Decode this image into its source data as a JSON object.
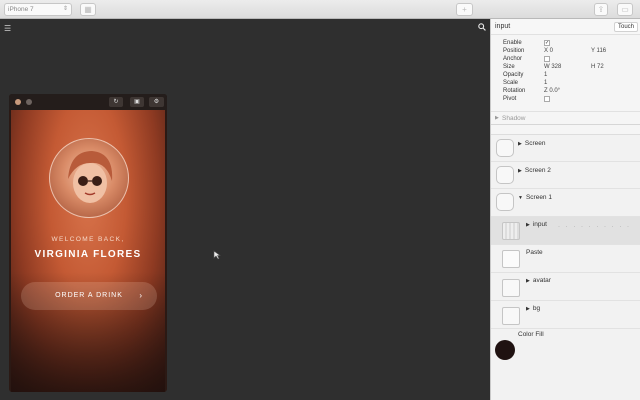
{
  "toolbar": {
    "device": "iPhone 7",
    "add_icon": "plus-icon",
    "share_icon": "share-icon",
    "panel_icon": "panel-icon"
  },
  "canvas": {
    "menu_icon": "hamburger-icon",
    "search_icon": "search-icon",
    "cursor_icon": "cursor-icon"
  },
  "phone": {
    "welcome": "WELCOME BACK,",
    "name": "VIRGINIA FLORES",
    "button_label": "ORDER A DRINK",
    "button_arrow": "›",
    "colors": {
      "accent": "#c45a34",
      "dark": "#2b1914"
    }
  },
  "inspector": {
    "title": "input",
    "badge": "Touch",
    "props": {
      "enable_label": "Enable",
      "enable_value": "✓",
      "position_label": "Position",
      "position_x": "X 0",
      "position_y": "Y 116",
      "anchor_label": "Anchor",
      "size_label": "Size",
      "size_w": "W 328",
      "size_h": "H 72",
      "opacity_label": "Opacity",
      "opacity_value": "1",
      "scale_label": "Scale",
      "scale_value": "1",
      "rotation_label": "Rotation",
      "rotation_value": "Z 0.0°",
      "pivot_label": "Pivot"
    },
    "shadow_label": "Shadow",
    "layers": [
      {
        "label": "Screen",
        "thumb": "apple-icon"
      },
      {
        "label": "Screen 2",
        "thumb": "apple-icon"
      },
      {
        "label": "Screen 1",
        "thumb": "apple-icon"
      },
      {
        "label": "input",
        "thumb": "input-thumbnail"
      },
      {
        "label": "Paste",
        "thumb": "paste-thumbnail"
      },
      {
        "label": "avatar",
        "thumb": "folder-icon"
      },
      {
        "label": "bg",
        "thumb": "folder-icon"
      },
      {
        "label": "Color Fill",
        "thumb": "color-swatch",
        "color": "#1f1211"
      }
    ]
  }
}
